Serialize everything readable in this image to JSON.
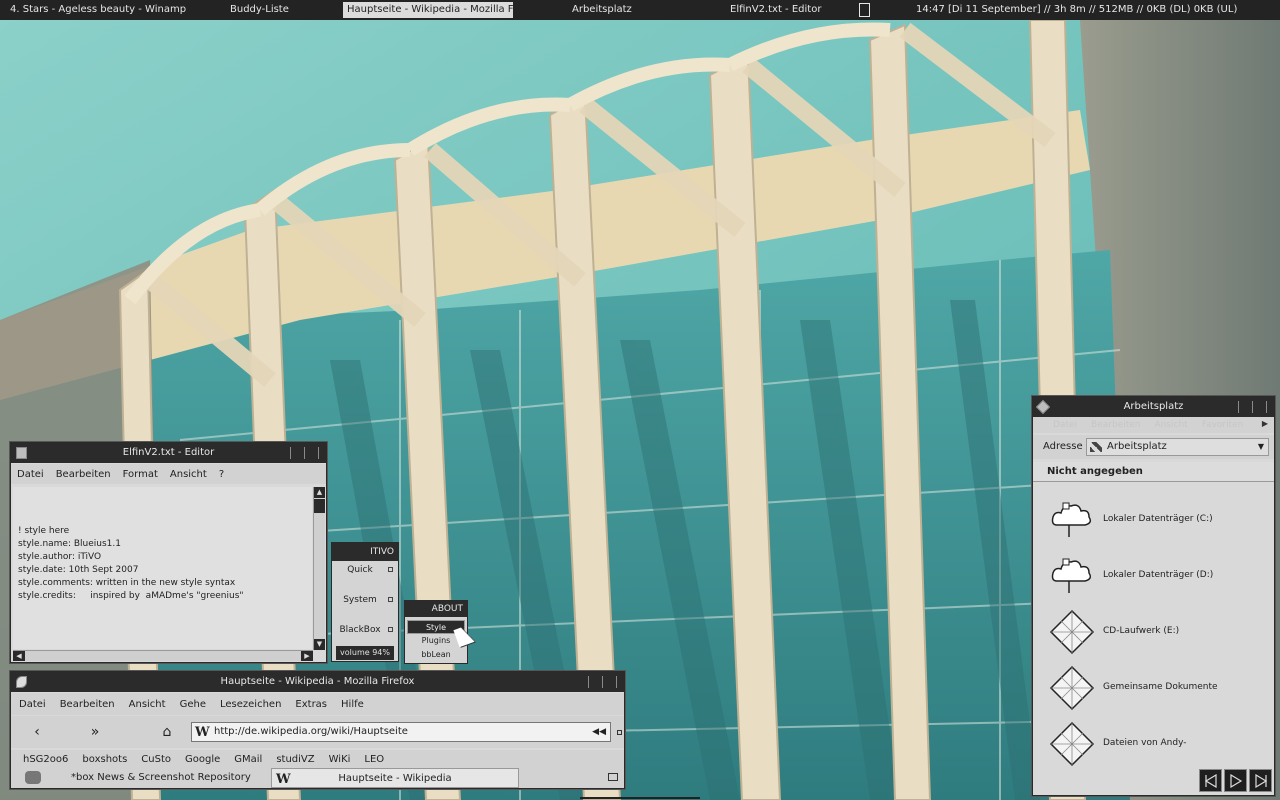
{
  "taskbar": {
    "tasks": [
      "4. Stars - Ageless beauty - Winamp",
      "Buddy-Liste",
      "Hauptseite - Wikipedia - Mozilla Fi...",
      "Arbeitsplatz",
      "ElfinV2.txt - Editor"
    ],
    "clock": "14:47  [Di 11 September] // 3h 8m // 512MB // 0KB (DL)  0KB (UL)"
  },
  "editor": {
    "title": "ElfinV2.txt - Editor",
    "menu": [
      "Datei",
      "Bearbeiten",
      "Format",
      "Ansicht",
      "?"
    ],
    "lines": [
      "! style here",
      "style.name: Blueius1.1",
      "style.author: iTiVO",
      "style.date: 10th Sept 2007",
      "style.comments: written in the new style syntax",
      "style.credits:     inspired by  aMADme's \"greenius\""
    ]
  },
  "bbmenu": {
    "title": "ITIVO",
    "items": [
      "Quick",
      "System",
      "BlackBox"
    ],
    "volume": "volume 94%"
  },
  "about": {
    "title": "ABOUT",
    "items": [
      "Style",
      "Plugins",
      "bbLean"
    ]
  },
  "firefox": {
    "title": "Hauptseite - Wikipedia - Mozilla Firefox",
    "menu": [
      "Datei",
      "Bearbeiten",
      "Ansicht",
      "Gehe",
      "Lesezeichen",
      "Extras",
      "Hilfe"
    ],
    "url": "http://de.wikipedia.org/wiki/Hauptseite",
    "bookmarks": [
      "hSG2oo6",
      "boxshots",
      "CuSto",
      "Google",
      "GMail",
      "studiVZ",
      "WiKi",
      "LEO"
    ],
    "tabs": [
      "*box News & Screenshot Repository",
      "Hauptseite - Wikipedia"
    ],
    "wiki_glyph": "W"
  },
  "explorer": {
    "title": "Arbeitsplatz",
    "ghost_menu": [
      "Datei",
      "Bearbeiten",
      "Ansicht",
      "Favoriten"
    ],
    "address_label": "Adresse",
    "address_value": "Arbeitsplatz",
    "group": "Nicht angegeben",
    "drives": [
      {
        "label": "Lokaler Datenträger (C:)",
        "icon": "cloud-drive-icon"
      },
      {
        "label": "Lokaler Datenträger (D:)",
        "icon": "cloud-drive-icon"
      },
      {
        "label": "CD-Laufwerk (E:)",
        "icon": "diamond-grid-icon"
      },
      {
        "label": "Gemeinsame Dokumente",
        "icon": "diamond-grid-icon"
      },
      {
        "label": "Dateien von Andy-",
        "icon": "diamond-grid-icon"
      }
    ]
  },
  "colors": {
    "bar": "#2b2b2b",
    "panel": "#d9d9d9",
    "sky": "#7cc6c2"
  }
}
